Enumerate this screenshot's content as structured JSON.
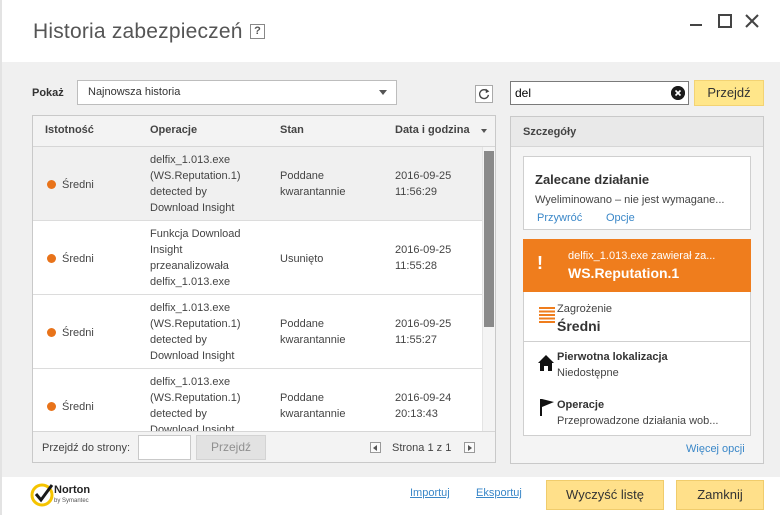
{
  "window": {
    "title": "Historia zabezpieczeń",
    "help_icon": "?"
  },
  "filter": {
    "label": "Pokaż",
    "selected": "Najnowsza historia"
  },
  "search": {
    "value": "del",
    "go_label": "Przejdź"
  },
  "table": {
    "columns": [
      "Istotność",
      "Operacje",
      "Stan",
      "Data i godzina"
    ],
    "rows": [
      {
        "severity": "Średni",
        "operation": [
          "delfix_1.013.exe",
          "(WS.Reputation.1)",
          "detected by",
          "Download Insight"
        ],
        "status": [
          "Poddane",
          "kwarantannie"
        ],
        "date": "2016-09-25",
        "time": "11:56:29"
      },
      {
        "severity": "Średni",
        "operation": [
          "Funkcja Download",
          "Insight",
          "przeanalizowała",
          "delfix_1.013.exe"
        ],
        "status": [
          "Usunięto"
        ],
        "date": "2016-09-25",
        "time": "11:55:28"
      },
      {
        "severity": "Średni",
        "operation": [
          "delfix_1.013.exe",
          "(WS.Reputation.1)",
          "detected by",
          "Download Insight"
        ],
        "status": [
          "Poddane",
          "kwarantannie"
        ],
        "date": "2016-09-25",
        "time": "11:55:27"
      },
      {
        "severity": "Średni",
        "operation": [
          "delfix_1.013.exe",
          "(WS.Reputation.1)",
          "detected by",
          "Download Insight"
        ],
        "status": [
          "Poddane",
          "kwarantannie"
        ],
        "date": "2016-09-24",
        "time": "20:13:43"
      }
    ],
    "pagination": {
      "goto_label": "Przejdź do strony:",
      "go_label": "Przejdź",
      "page_text": "Strona 1 z 1"
    }
  },
  "details": {
    "title": "Szczegóły",
    "recommended": {
      "title": "Zalecane działanie",
      "description": "Wyeliminowano – nie jest wymagane...",
      "restore_link": "Przywróć",
      "options_link": "Opcje"
    },
    "alert": {
      "line1": "delfix_1.013.exe zawierał za...",
      "line2": "WS.Reputation.1"
    },
    "threat": {
      "label": "Zagrożenie",
      "value": "Średni"
    },
    "origin": {
      "label": "Pierwotna lokalizacja",
      "value": "Niedostępne"
    },
    "operations": {
      "label": "Operacje",
      "value": "Przeprowadzone działania wob..."
    },
    "more_link": "Więcej opcji"
  },
  "footer": {
    "logo_text": "Norton",
    "logo_sub": "by Symantec",
    "import": "Importuj",
    "export": "Eksportuj",
    "clear_list": "Wyczyść listę",
    "close": "Zamknij"
  },
  "colors": {
    "accent_yellow": "#ffe08a",
    "alert_orange": "#ef7d1d",
    "severity_dot": "#e8731a",
    "link_blue": "#3a87c8"
  }
}
